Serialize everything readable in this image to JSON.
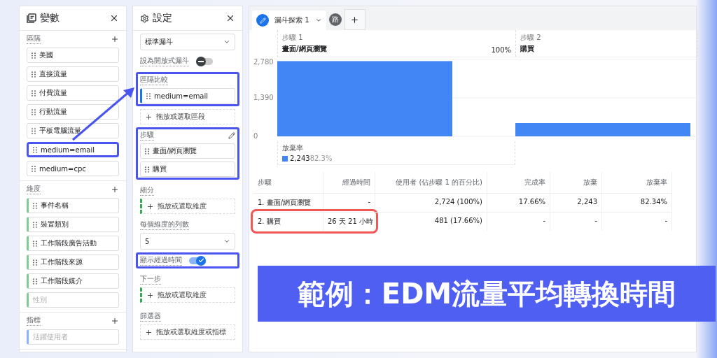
{
  "variables_panel": {
    "title": "變數",
    "sections": [
      {
        "title": "區隔",
        "kind": "segment",
        "items": [
          {
            "label": "美國",
            "disabled": false,
            "highlighted": false
          },
          {
            "label": "直接流量",
            "disabled": false,
            "highlighted": false
          },
          {
            "label": "付費流量",
            "disabled": false,
            "highlighted": false
          },
          {
            "label": "行動流量",
            "disabled": false,
            "highlighted": false
          },
          {
            "label": "平板電腦流量",
            "disabled": false,
            "highlighted": false
          },
          {
            "label": "medium=email",
            "disabled": false,
            "highlighted": true
          },
          {
            "label": "medium=cpc",
            "disabled": false,
            "highlighted": false
          }
        ]
      },
      {
        "title": "維度",
        "kind": "dimension",
        "items": [
          {
            "label": "事件名稱",
            "disabled": false,
            "highlighted": false
          },
          {
            "label": "裝置類別",
            "disabled": false,
            "highlighted": false
          },
          {
            "label": "工作階段廣告活動",
            "disabled": false,
            "highlighted": false
          },
          {
            "label": "工作階段來源",
            "disabled": false,
            "highlighted": false
          },
          {
            "label": "工作階段媒介",
            "disabled": false,
            "highlighted": false
          },
          {
            "label": "性別",
            "disabled": true,
            "highlighted": false
          }
        ]
      },
      {
        "title": "指標",
        "kind": "metric",
        "items": [
          {
            "label": "活躍使用者",
            "disabled": true,
            "highlighted": false
          }
        ]
      }
    ]
  },
  "settings_panel": {
    "title": "設定",
    "sections": [
      {
        "kind": "select",
        "value": "標準漏斗"
      },
      {
        "kind": "toggle",
        "label": "設為開放式漏斗",
        "on": false,
        "highlighted": false
      },
      {
        "kind": "list",
        "title": "區隔比較",
        "highlighted": true,
        "items": [
          "medium=email"
        ],
        "accented": false,
        "drop_hint": "拖放或選取區段"
      },
      {
        "kind": "steps",
        "title": "步驟",
        "highlighted": true,
        "items": [
          "畫面/網頁瀏覽",
          "購買"
        ]
      },
      {
        "kind": "list",
        "title": "細分",
        "highlighted": false,
        "accented": true,
        "drop_hint": "拖放或選取維度"
      },
      {
        "kind": "select",
        "title": "每個維度的列數",
        "value": "5"
      },
      {
        "kind": "toggle",
        "label": "顯示經過時間",
        "on": true,
        "highlighted": true
      },
      {
        "kind": "list",
        "title": "下一步",
        "highlighted": false,
        "accented": true,
        "drop_hint": "拖放或選取維度"
      },
      {
        "kind": "list",
        "title": "篩選器",
        "highlighted": false,
        "accented": false,
        "drop_hint": "拖放或選取維度或指標"
      }
    ]
  },
  "tabs": [
    {
      "label": "漏斗探索 1",
      "selected": true
    },
    {
      "label": "路",
      "selected": false
    }
  ],
  "funnel_chart": {
    "steps": [
      {
        "name": "畫面/網頁瀏覽",
        "percent": "100%"
      },
      {
        "name": "購買"
      }
    ],
    "abandonment": {
      "label": "放棄率",
      "count": "2,243",
      "rate": "82.3%"
    },
    "chart_data": {
      "type": "bar",
      "categories": [
        "步驟 1",
        "步驟 2"
      ],
      "values": [
        2720,
        480
      ],
      "ylim": [
        0,
        2780
      ],
      "yticks": [
        {
          "value": 0,
          "label": "0"
        },
        {
          "value": 1390,
          "label": "1,390"
        },
        {
          "value": 2780,
          "label": "2,780"
        }
      ]
    }
  },
  "table": {
    "columns": [
      "步驟",
      "經過時間",
      "使用者 (佔步驟 1 的百分比)",
      "完成率",
      "放棄",
      "放棄率"
    ],
    "rows": [
      {
        "cells": [
          "1. 畫面/網頁瀏覽",
          "-",
          "2,724 (100%)",
          "17.66%",
          "2,243",
          "82.34%"
        ],
        "highlighted": false
      },
      {
        "cells": [
          "2. 購買",
          "26 天 21 小時",
          "481 (17.66%)",
          "-",
          "-",
          "-"
        ],
        "highlighted": true
      }
    ]
  },
  "banner": {
    "text": "範例：EDM流量平均轉換時間"
  }
}
